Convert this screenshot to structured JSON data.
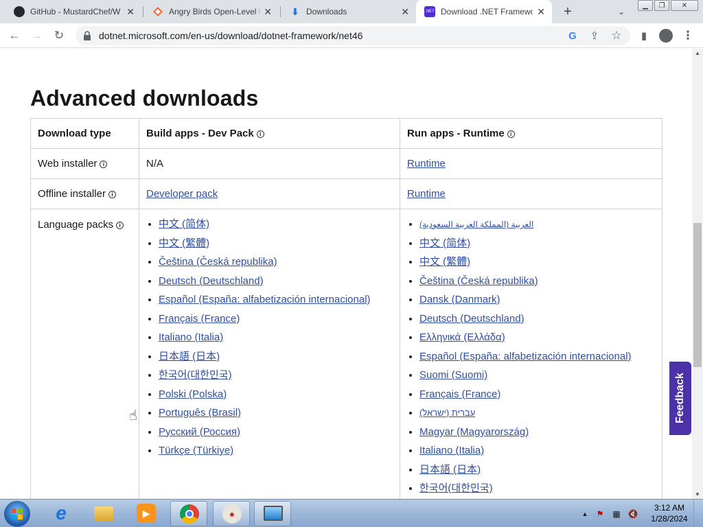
{
  "browser": {
    "tabs": [
      {
        "title": "GitHub - MustardChef/W",
        "icon": "github-icon",
        "active": false
      },
      {
        "title": "Angry Birds Open-Level E",
        "icon": "diamond-icon",
        "active": false
      },
      {
        "title": "Downloads",
        "icon": "download-icon",
        "active": false
      },
      {
        "title": "Download .NET Framewo",
        "icon": "dotnet-icon",
        "active": true
      }
    ],
    "url": "dotnet.microsoft.com/en-us/download/dotnet-framework/net46"
  },
  "page": {
    "heading": "Advanced downloads",
    "table": {
      "headers": {
        "type": "Download type",
        "dev": "Build apps - Dev Pack",
        "run": "Run apps - Runtime"
      },
      "rows": {
        "web": {
          "label": "Web installer",
          "dev": "N/A",
          "run": "Runtime"
        },
        "offline": {
          "label": "Offline installer",
          "dev": "Developer pack",
          "run": "Runtime"
        },
        "lang": {
          "label": "Language packs"
        }
      },
      "dev_languages": [
        "中文 (简体)",
        "中文 (繁體)",
        "Čeština (Česká republika)",
        "Deutsch (Deutschland)",
        "Español (España: alfabetización internacional)",
        "Français (France)",
        "Italiano (Italia)",
        "日本語 (日本)",
        "한국어(대한민국)",
        "Polski (Polska)",
        "Português (Brasil)",
        "Русский (Россия)",
        "Türkçe (Türkiye)"
      ],
      "run_languages": [
        "العربية (المملكة العربية السعودية)",
        "中文 (简体)",
        "中文 (繁體)",
        "Čeština (Česká republika)",
        "Dansk (Danmark)",
        "Deutsch (Deutschland)",
        "Ελληνικά (Ελλάδα)",
        "Español (España: alfabetización internacional)",
        "Suomi (Suomi)",
        "Français (France)",
        "עברית (ישראל)",
        "Magyar (Magyarország)",
        "Italiano (Italia)",
        "日本語 (日本)",
        "한국어(대한민국)"
      ]
    },
    "feedback": "Feedback"
  },
  "taskbar": {
    "time": "3:12 AM",
    "date": "1/28/2024"
  },
  "colors": {
    "link": "#2f4f9f",
    "feedback": "#4c32a8"
  }
}
